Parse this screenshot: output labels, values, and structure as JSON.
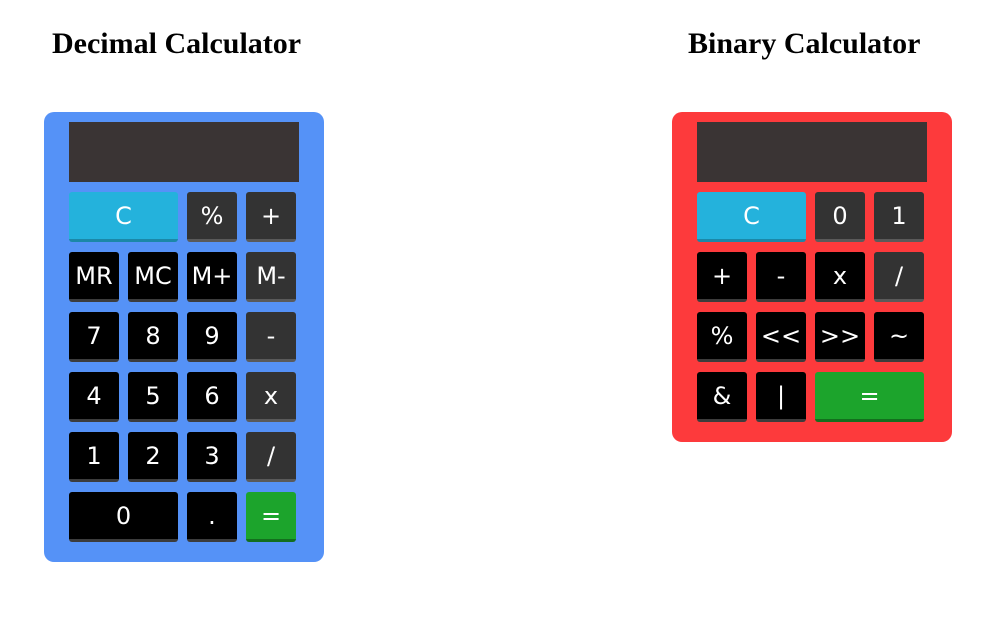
{
  "decimal": {
    "title": "Decimal Calculator",
    "display": "",
    "keys": {
      "clear": "C",
      "percent": "%",
      "plus": "+",
      "mr": "MR",
      "mc": "MC",
      "mplus": "M+",
      "mminus": "M-",
      "seven": "7",
      "eight": "8",
      "nine": "9",
      "minus": "-",
      "four": "4",
      "five": "5",
      "six": "6",
      "multiply": "x",
      "one": "1",
      "two": "2",
      "three": "3",
      "divide": "/",
      "zero": "0",
      "dot": ".",
      "equals": "="
    }
  },
  "binary": {
    "title": "Binary Calculator",
    "display": "",
    "keys": {
      "clear": "C",
      "zero": "0",
      "one": "1",
      "plus": "+",
      "minus": "-",
      "multiply": "x",
      "divide": "/",
      "percent": "%",
      "shift_left": "<<",
      "shift_right": ">>",
      "not": "~",
      "and": "&",
      "or": "|",
      "equals": "="
    }
  },
  "colors": {
    "decimal_body": "#5592f7",
    "binary_body": "#fd3a3c",
    "screen": "#3a3434",
    "clear_key": "#24b2dc",
    "equals_key": "#1ca42c",
    "operator_key": "#333333",
    "digit_key": "#000000"
  }
}
